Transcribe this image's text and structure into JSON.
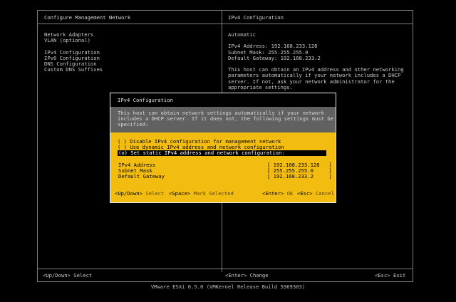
{
  "header": {
    "left_title": "Configure Management Network",
    "right_title": "IPv4 Configuration"
  },
  "menu": {
    "items": [
      "Network Adapters",
      "VLAN (optional)",
      "",
      "IPv4 Configuration",
      "IPv6 Configuration",
      "DNS Configuration",
      "Custom DNS Suffixes"
    ]
  },
  "info": {
    "mode": "Automatic",
    "ipv4_address": "IPv4 Address: 192.168.233.128",
    "subnet_mask": "Subnet Mask: 255.255.255.0",
    "default_gateway": "Default Gateway: 192.168.233.2",
    "description": [
      "This host can obtain an IPv4 address and other networking",
      "parameters automatically if your network includes a DHCP",
      "server. If not, ask your network administrator for the",
      "appropriate settings."
    ]
  },
  "dialog": {
    "title": "IPv4 Configuration",
    "description": [
      "This host can obtain network settings automatically if your network",
      "includes a DHCP server. If it does not, the following settings must be",
      "specified:"
    ],
    "options": [
      "( ) Disable IPv4 configuration for management network",
      "( ) Use dynamic IPv4 address and network configuration",
      "(o) Set static IPv4 address and network configuration:"
    ],
    "fields": [
      {
        "label": "IPv4 Address",
        "value": "[ 192.168.233.128   ]"
      },
      {
        "label": "Subnet Mask",
        "value": "[ 255.255.255.0     ]"
      },
      {
        "label": "Default Gateway",
        "value": "[ 192.168.233.2     ]"
      }
    ],
    "footer": {
      "up_down_key": "<Up/Down>",
      "up_down_action": "Select",
      "space_key": "<Space>",
      "space_action": "Mark Selected",
      "enter_key": "<Enter>",
      "enter_action": "OK",
      "esc_key": "<Esc>",
      "esc_action": "Cancel"
    }
  },
  "footer": {
    "left": "<Up/Down> Select",
    "center": "<Enter> Change",
    "right": "<Esc> Exit"
  },
  "version": "VMware ESXi 6.5.0 (VMKernel Release Build 5969303)"
}
